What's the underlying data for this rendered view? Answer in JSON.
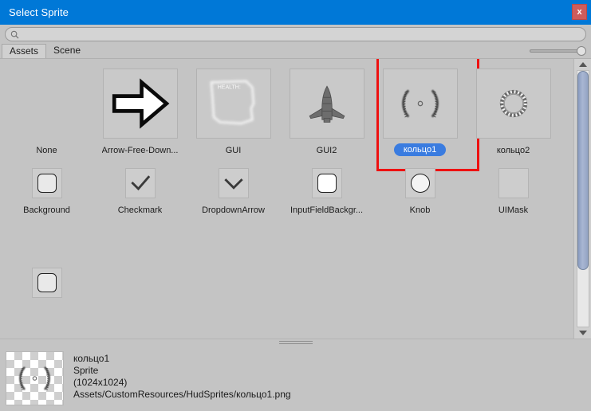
{
  "window": {
    "title": "Select Sprite",
    "close_label": "x",
    "titlebar_color": "#0078d7",
    "close_color": "#cd5c5c",
    "accent_selected": "#3a7ce0",
    "highlight_outline": "#ee1111",
    "background": "#c4c4c4"
  },
  "search": {
    "value": "",
    "placeholder": "",
    "icon": "search-icon"
  },
  "tabs": [
    {
      "label": "Assets",
      "active": true
    },
    {
      "label": "Scene",
      "active": false
    }
  ],
  "zoom_slider": {
    "value": 100,
    "position": "right"
  },
  "grid": {
    "rows": [
      [
        {
          "label": "None",
          "art": "none",
          "selected": false
        },
        {
          "label": "Arrow-Free-Down...",
          "art": "arrow",
          "selected": false
        },
        {
          "label": "GUI",
          "art": "gui",
          "selected": false
        },
        {
          "label": "GUI2",
          "art": "gui2",
          "selected": false
        },
        {
          "label": "кольцо1",
          "art": "koltso1",
          "selected": true
        },
        {
          "label": "кольцо2",
          "art": "koltso2",
          "selected": false
        }
      ],
      [
        {
          "label": "Background",
          "art": "background",
          "selected": false
        },
        {
          "label": "Checkmark",
          "art": "checkmark",
          "selected": false
        },
        {
          "label": "DropdownArrow",
          "art": "dropdownarrow",
          "selected": false
        },
        {
          "label": "InputFieldBackgr...",
          "art": "inputfield",
          "selected": false
        },
        {
          "label": "Knob",
          "art": "knob",
          "selected": false
        },
        {
          "label": "UIMask",
          "art": "uimask",
          "selected": false
        }
      ],
      [
        {
          "label": "",
          "art": "background",
          "selected": false
        }
      ]
    ]
  },
  "scrollbar": {
    "up_arrow": "triangle-up-icon",
    "down_arrow": "triangle-down-icon",
    "thumb_position": "top"
  },
  "detail": {
    "name": "кольцо1",
    "type": "Sprite",
    "dimensions": "(1024x1024)",
    "path": "Assets/CustomResources/HudSprites/кольцо1.png"
  }
}
